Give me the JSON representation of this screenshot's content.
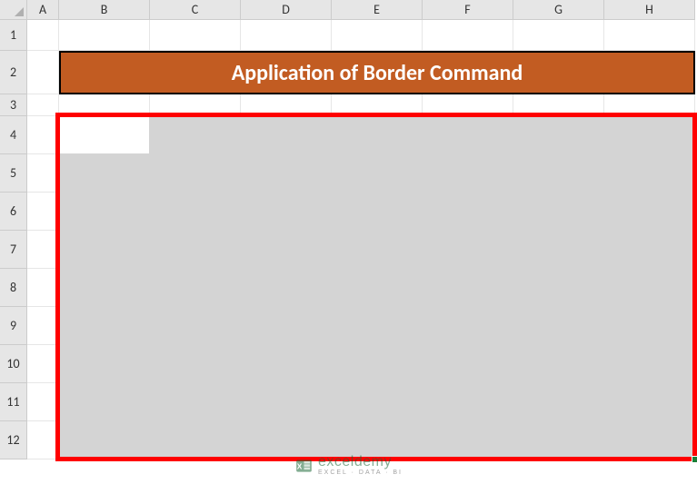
{
  "columns": [
    "A",
    "B",
    "C",
    "D",
    "E",
    "F",
    "G",
    "H"
  ],
  "rows": [
    "1",
    "2",
    "3",
    "4",
    "5",
    "6",
    "7",
    "8",
    "9",
    "10",
    "11",
    "12"
  ],
  "title": "Application of Border Command",
  "selection_range": "B4:H12",
  "active_cell": "B4",
  "watermark": {
    "main": "exceldemy",
    "sub": "EXCEL · DATA · BI"
  },
  "chart_data": {
    "type": "table",
    "title": "Application of Border Command",
    "categories": [],
    "values": []
  }
}
